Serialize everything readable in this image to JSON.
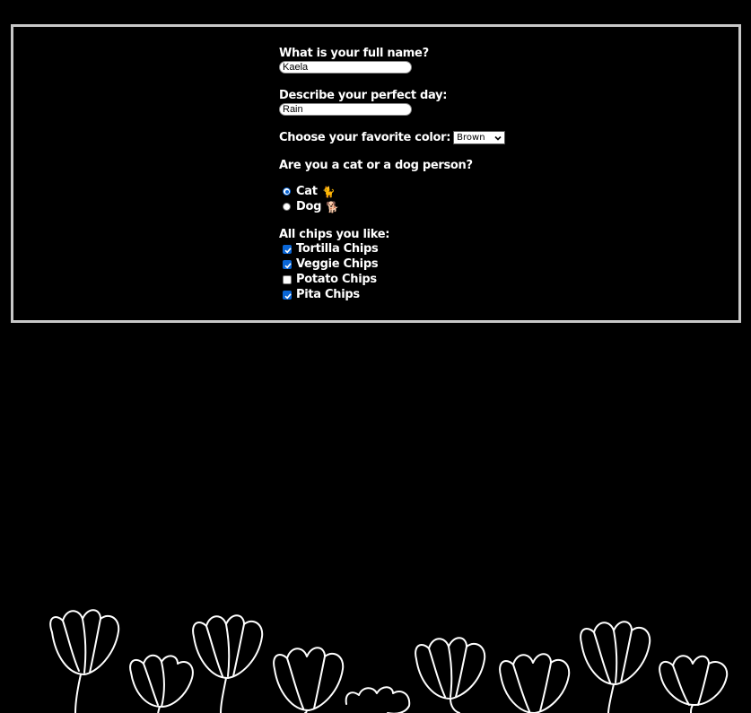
{
  "form": {
    "name_question": "What is your full name?",
    "name_value": "Kaela",
    "day_question": "Describe your perfect day:",
    "day_value": "Rain",
    "color_question": "Choose your favorite color:",
    "color_selected": "Brown",
    "pet_question": "Are you a cat or a dog person?",
    "pet_options": [
      {
        "label": "Cat",
        "emoji": "🐈",
        "checked": true
      },
      {
        "label": "Dog",
        "emoji": "🐕",
        "checked": false
      }
    ],
    "chips_question": "All chips you like:",
    "chips": [
      {
        "label": "Tortilla Chips",
        "checked": true
      },
      {
        "label": "Veggie Chips",
        "checked": true
      },
      {
        "label": "Potato Chips",
        "checked": false
      },
      {
        "label": "Pita Chips",
        "checked": true
      }
    ]
  },
  "colors": {
    "background": "#000000",
    "frame_border": "#c8c8c8",
    "text": "#ffffff",
    "accent": "#0a66d6"
  },
  "decor": {
    "footer_illustration": "tulip-outline-icon"
  }
}
